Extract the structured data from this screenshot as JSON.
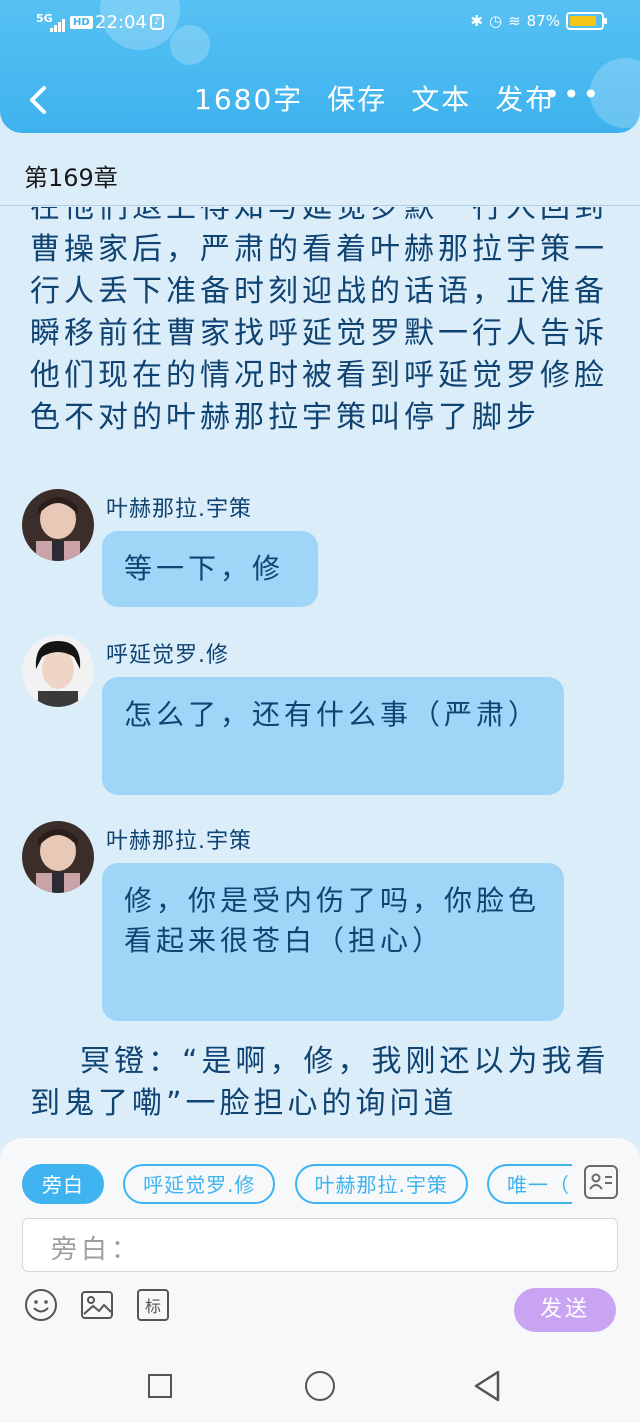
{
  "status_bar": {
    "network": "5G",
    "hd": "HD",
    "time": "22:04",
    "battery": "87%",
    "battery_level": 0.87
  },
  "header": {
    "word_count": "1680字",
    "save": "保存",
    "text": "文本",
    "publish": "发布",
    "more": "•••"
  },
  "chapter": {
    "title": "第169章"
  },
  "content": {
    "narration_top": "在他们退上得知与延觉罗默一行人回到曹操家后，严肃的看着叶赫那拉宇策一行人丢下准备时刻迎战的话语，正准备瞬移前往曹家找呼延觉罗默一行人告诉他们现在的情况时被看到呼延觉罗修脸色不对的叶赫那拉宇策叫停了脚步",
    "messages": [
      {
        "name": "叶赫那拉.宇策",
        "text": "等一下，修"
      },
      {
        "name": "呼延觉罗.修",
        "text": "怎么了，还有什么事（严肃）"
      },
      {
        "name": "叶赫那拉.宇策",
        "text": "修，你是受内伤了吗，你脸色看起来很苍白（担心）"
      }
    ],
    "narration_bottom": "冥镫：“是啊，修，我刚还以为我看到鬼了嘞”一脸担心的询问道"
  },
  "composer": {
    "roles": [
      "旁白",
      "呼延觉罗.修",
      "叶赫那拉.宇策",
      "唯一（"
    ],
    "active_role": "旁白",
    "placeholder": "旁白：",
    "tag_label": "标",
    "send": "发送"
  },
  "colors": {
    "header": "#3eb2ee",
    "background": "#dcedfa",
    "bubble": "#9fd6f7",
    "text": "#0f4372",
    "send": "#c8a4f2",
    "chip": "#3fb3ef"
  }
}
